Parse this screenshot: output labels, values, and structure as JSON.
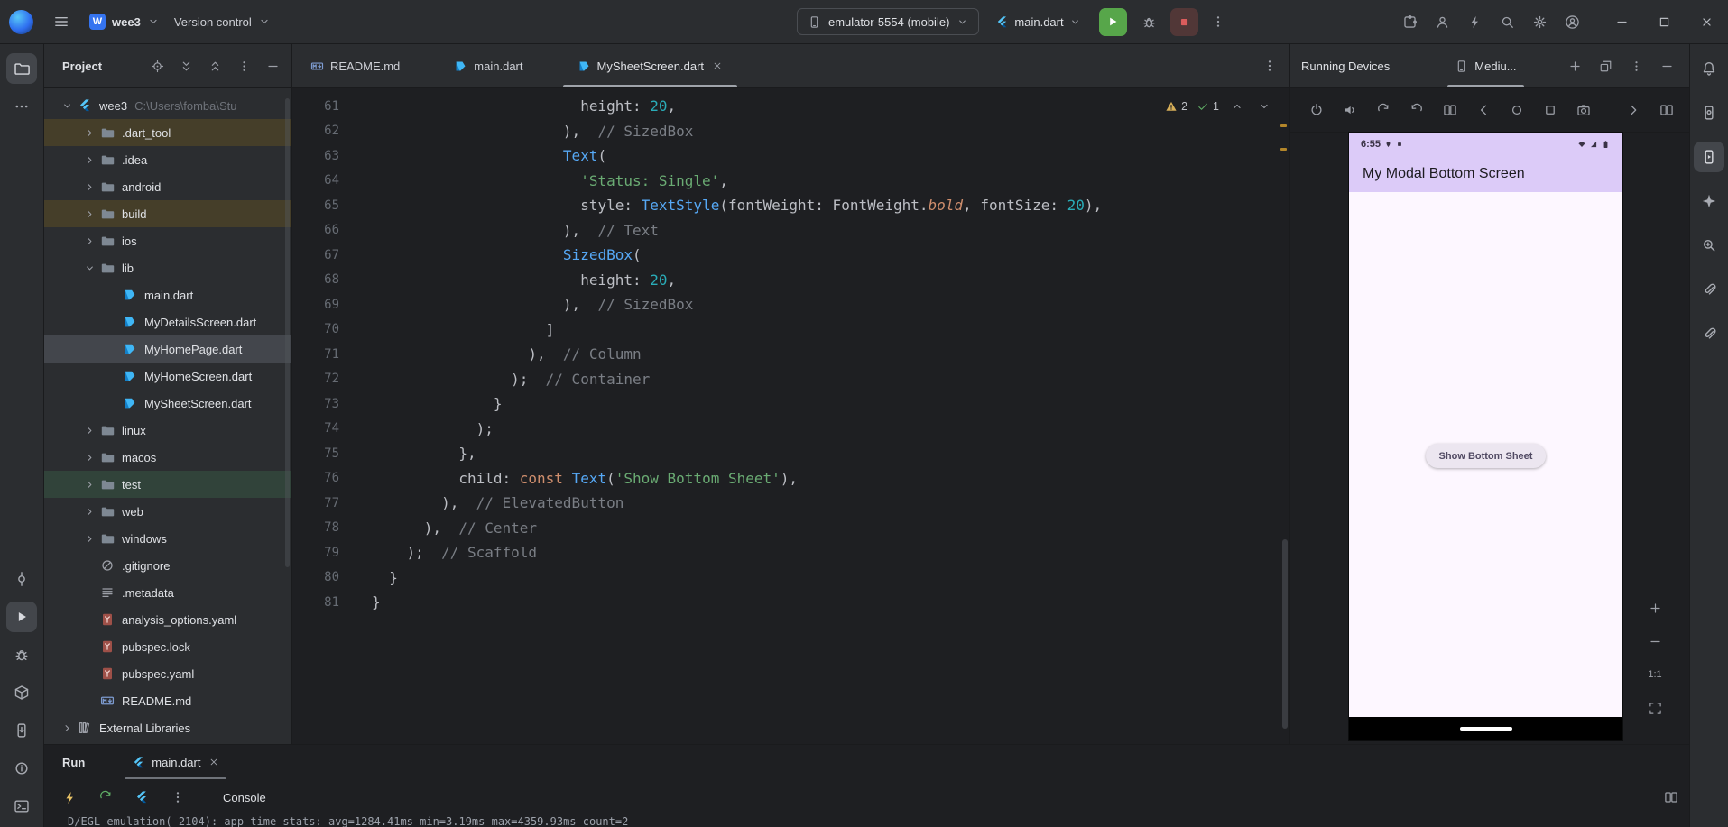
{
  "titlebar": {
    "project_name": "wee3",
    "project_avatar_letter": "W",
    "vcs_label": "Version control",
    "device_selector": "emulator-5554 (mobile)",
    "run_config": "main.dart",
    "right_icons": [
      {
        "icon": "puzzle",
        "name": "plugins-button"
      },
      {
        "icon": "user",
        "name": "code-with-me-button"
      },
      {
        "icon": "bolt",
        "name": "ai-assistant-button"
      },
      {
        "icon": "search",
        "name": "search-everywhere-button"
      },
      {
        "icon": "gear",
        "name": "settings-button"
      },
      {
        "icon": "avatar",
        "name": "profile-button"
      }
    ],
    "window_buttons": [
      {
        "icon": "minus",
        "name": "window-minimize-button"
      },
      {
        "icon": "win-max",
        "name": "window-maximize-button"
      },
      {
        "icon": "close",
        "name": "window-close-button"
      }
    ]
  },
  "left_strip": {
    "top": [
      {
        "icon": "folder-o",
        "name": "project-tool-button",
        "active": true
      },
      {
        "icon": "meatballs",
        "name": "more-tool-windows-button"
      }
    ],
    "bottom": [
      {
        "icon": "commit",
        "name": "commit-tool-button"
      },
      {
        "icon": "play",
        "name": "run-tool-button",
        "active": true
      },
      {
        "icon": "bug",
        "name": "debug-tool-button"
      },
      {
        "icon": "package",
        "name": "build-tool-button"
      },
      {
        "icon": "phone-down",
        "name": "device-explorer-button"
      },
      {
        "icon": "info",
        "name": "problems-tool-button"
      },
      {
        "icon": "terminal",
        "name": "terminal-tool-button"
      }
    ]
  },
  "right_strip": {
    "items": [
      {
        "icon": "bell",
        "name": "notifications-button"
      },
      {
        "icon": "phone-gear",
        "name": "device-manager-button"
      },
      {
        "icon": "phone-play",
        "name": "running-devices-button",
        "active": true
      },
      {
        "icon": "star4",
        "name": "gemini-button"
      },
      {
        "icon": "insights",
        "name": "app-quality-insights-button"
      },
      {
        "icon": "clip",
        "name": "device-file-explorer-button"
      },
      {
        "icon": "clip",
        "name": "attach-debugger-button"
      }
    ]
  },
  "project_panel": {
    "title": "Project",
    "header_icons": [
      {
        "icon": "target",
        "name": "locate-file-button"
      },
      {
        "icon": "expand",
        "name": "expand-all-button"
      },
      {
        "icon": "collapse",
        "name": "collapse-all-button"
      },
      {
        "icon": "kebab",
        "name": "project-options-button"
      },
      {
        "icon": "minus",
        "name": "hide-project-button"
      }
    ],
    "tree": [
      {
        "label": "wee3",
        "suffix": "C:\\Users\\fomba\\Stu",
        "icon": "flutter",
        "level": 0,
        "chevron": "down"
      },
      {
        "label": ".dart_tool",
        "icon": "folder",
        "level": 1,
        "chevron": "right",
        "bg": "excluded"
      },
      {
        "label": ".idea",
        "icon": "folder",
        "level": 1,
        "chevron": "right"
      },
      {
        "label": "android",
        "icon": "folder",
        "level": 1,
        "chevron": "right"
      },
      {
        "label": "build",
        "icon": "folder",
        "level": 1,
        "chevron": "right",
        "bg": "excluded"
      },
      {
        "label": "ios",
        "icon": "folder",
        "level": 1,
        "chevron": "right"
      },
      {
        "label": "lib",
        "icon": "folder",
        "level": 1,
        "chevron": "down"
      },
      {
        "label": "main.dart",
        "icon": "dart",
        "level": 2
      },
      {
        "label": "MyDetailsScreen.dart",
        "icon": "dart",
        "level": 2
      },
      {
        "label": "MyHomePage.dart",
        "icon": "dart",
        "level": 2,
        "bg": "selected"
      },
      {
        "label": "MyHomeScreen.dart",
        "icon": "dart",
        "level": 2
      },
      {
        "label": "MySheetScreen.dart",
        "icon": "dart",
        "level": 2
      },
      {
        "label": "linux",
        "icon": "folder",
        "level": 1,
        "chevron": "right"
      },
      {
        "label": "macos",
        "icon": "folder",
        "level": 1,
        "chevron": "right"
      },
      {
        "label": "test",
        "icon": "folder",
        "level": 1,
        "chevron": "right",
        "bg": "test"
      },
      {
        "label": "web",
        "icon": "folder",
        "level": 1,
        "chevron": "right"
      },
      {
        "label": "windows",
        "icon": "folder",
        "level": 1,
        "chevron": "right"
      },
      {
        "label": ".gitignore",
        "icon": "ignore",
        "level": 1
      },
      {
        "label": ".metadata",
        "icon": "lines",
        "level": 1
      },
      {
        "label": "analysis_options.yaml",
        "icon": "yaml",
        "level": 1
      },
      {
        "label": "pubspec.lock",
        "icon": "yaml",
        "level": 1
      },
      {
        "label": "pubspec.yaml",
        "icon": "yaml",
        "level": 1
      },
      {
        "label": "README.md",
        "icon": "md",
        "level": 1
      },
      {
        "label": "External Libraries",
        "icon": "extlib",
        "level": 0,
        "chevron": "right"
      }
    ]
  },
  "editor": {
    "tabs": [
      {
        "label": "README.md",
        "icon": "md",
        "name": "tab-readme"
      },
      {
        "label": "main.dart",
        "icon": "dart",
        "name": "tab-main-dart"
      },
      {
        "label": "MySheetScreen.dart",
        "icon": "dart",
        "name": "tab-mysheetscreen-dart",
        "active": true,
        "closable": true
      }
    ],
    "inspections": {
      "warnings": "2",
      "ok": "1"
    },
    "first_line": 61,
    "code": [
      {
        "n": 61,
        "t": [
          [
            "d",
            "                        height: "
          ],
          [
            "num",
            "20"
          ],
          [
            "d",
            ","
          ]
        ]
      },
      {
        "n": 62,
        "t": [
          [
            "d",
            "                      ),"
          ],
          [
            "com",
            "  // SizedBox"
          ]
        ]
      },
      {
        "n": 63,
        "t": [
          [
            "d",
            "                      "
          ],
          [
            "cls",
            "Text"
          ],
          [
            "d",
            "("
          ]
        ]
      },
      {
        "n": 64,
        "t": [
          [
            "d",
            "                        "
          ],
          [
            "str",
            "'Status: Single'"
          ],
          [
            "d",
            ","
          ]
        ]
      },
      {
        "n": 65,
        "t": [
          [
            "d",
            "                        style: "
          ],
          [
            "cls",
            "TextStyle"
          ],
          [
            "d",
            "(fontWeight: FontWeight."
          ],
          [
            "kwi",
            "bold"
          ],
          [
            "d",
            ", fontSize: "
          ],
          [
            "num",
            "20"
          ],
          [
            "d",
            "),"
          ]
        ]
      },
      {
        "n": 66,
        "t": [
          [
            "d",
            "                      ),"
          ],
          [
            "com",
            "  // Text"
          ]
        ]
      },
      {
        "n": 67,
        "t": [
          [
            "d",
            "                      "
          ],
          [
            "cls",
            "SizedBox"
          ],
          [
            "d",
            "("
          ]
        ]
      },
      {
        "n": 68,
        "t": [
          [
            "d",
            "                        height: "
          ],
          [
            "num",
            "20"
          ],
          [
            "d",
            ","
          ]
        ]
      },
      {
        "n": 69,
        "t": [
          [
            "d",
            "                      ),"
          ],
          [
            "com",
            "  // SizedBox"
          ]
        ]
      },
      {
        "n": 70,
        "t": [
          [
            "d",
            "                    ]"
          ]
        ]
      },
      {
        "n": 71,
        "t": [
          [
            "d",
            "                  ),"
          ],
          [
            "com",
            "  // Column"
          ]
        ]
      },
      {
        "n": 72,
        "t": [
          [
            "d",
            "                );"
          ],
          [
            "com",
            "  // Container"
          ]
        ]
      },
      {
        "n": 73,
        "t": [
          [
            "d",
            "              }"
          ]
        ]
      },
      {
        "n": 74,
        "t": [
          [
            "d",
            "            );"
          ]
        ]
      },
      {
        "n": 75,
        "t": [
          [
            "d",
            "          },"
          ]
        ]
      },
      {
        "n": 76,
        "t": [
          [
            "d",
            "          child: "
          ],
          [
            "kw",
            "const "
          ],
          [
            "cls",
            "Text"
          ],
          [
            "d",
            "("
          ],
          [
            "str",
            "'Show Bottom Sheet'"
          ],
          [
            "d",
            "),"
          ]
        ]
      },
      {
        "n": 77,
        "t": [
          [
            "d",
            "        ),"
          ],
          [
            "com",
            "  // ElevatedButton"
          ]
        ]
      },
      {
        "n": 78,
        "t": [
          [
            "d",
            "      ),"
          ],
          [
            "com",
            "  // Center"
          ]
        ]
      },
      {
        "n": 79,
        "t": [
          [
            "d",
            "    );"
          ],
          [
            "com",
            "  // Scaffold"
          ]
        ]
      },
      {
        "n": 80,
        "t": [
          [
            "d",
            "  }"
          ]
        ]
      },
      {
        "n": 81,
        "t": [
          [
            "d",
            "}"
          ]
        ]
      }
    ]
  },
  "devices_panel": {
    "title": "Running Devices",
    "device_tab": "Mediu...",
    "header_icons": [
      {
        "icon": "plus",
        "name": "add-device-button"
      },
      {
        "icon": "float",
        "name": "float-window-button"
      },
      {
        "icon": "kebab",
        "name": "devices-options-button"
      },
      {
        "icon": "minus",
        "name": "hide-devices-button"
      }
    ],
    "toolbar": [
      {
        "icon": "power",
        "name": "power-button"
      },
      {
        "icon": "volume",
        "name": "volume-button"
      },
      {
        "icon": "rotate",
        "name": "rotate-left-button"
      },
      {
        "icon": "rotate",
        "name": "rotate-right-button",
        "flip": true
      },
      {
        "icon": "split",
        "name": "fold-device-button"
      },
      {
        "icon": "back",
        "name": "android-back-button"
      },
      {
        "icon": "circle",
        "name": "android-home-button"
      },
      {
        "icon": "square",
        "name": "android-overview-button"
      },
      {
        "icon": "camera",
        "name": "screenshot-button"
      },
      {
        "icon": "chevr",
        "name": "more-device-actions-button",
        "push": true
      },
      {
        "icon": "split",
        "name": "display-mode-button"
      }
    ],
    "zoom": [
      {
        "icon": "plus",
        "name": "zoom-in-button"
      },
      {
        "icon": "minus",
        "name": "zoom-out-button"
      },
      {
        "label": "1:1",
        "name": "zoom-actual-size-button"
      },
      {
        "icon": "fit",
        "name": "zoom-to-fit-button"
      }
    ],
    "emulator": {
      "status_time": "6:55",
      "app_title": "My Modal Bottom Screen",
      "button_label": "Show Bottom Sheet"
    }
  },
  "run_panel": {
    "title": "Run",
    "tab_label": "main.dart",
    "console_label": "Console",
    "console_line": "D/EGL_emulation( 2104): app_time_stats: avg=1284.41ms min=3.19ms max=4359.93ms count=2"
  },
  "colors": {
    "run_green": "#57A64A",
    "stop_red": "#DB5C5C",
    "warning_yellow": "#D6AE58",
    "ok_green": "#5FAD65",
    "hot_reload_yellow": "#E8C266",
    "emulator_bar": "#DCCBF8",
    "emulator_body": "#FDF7FF",
    "accent_blue": "#3574F0"
  }
}
